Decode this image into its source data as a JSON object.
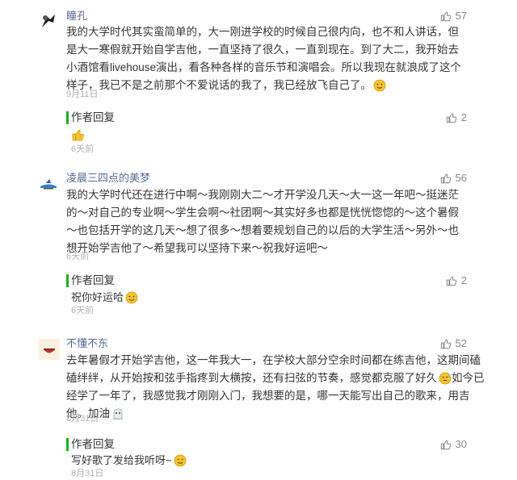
{
  "comments": [
    {
      "username": "瞳孔",
      "likes": "57",
      "text": "我的大学时代其实蛮简单的，大一刚进学校的时候自己很内向，也不和人讲话，但是大一寒假就开始自学吉他，一直坚持了很久，一直到现在。到了大二，我开始去小酒馆看livehouse演出，看各种各样的音乐节和演唱会。所以我现在就浪成了这个样子，我已不是之前那个不爱说话的我了，我已经放飞自己了。",
      "date": "9月11日",
      "reply": {
        "label": "作者回复",
        "likes": "2",
        "text": "",
        "date": "6天前",
        "emoji": "thumbs-up-emoji"
      }
    },
    {
      "username": "凌晨三四点的美梦",
      "likes": "56",
      "text": "我的大学时代还在进行中啊～我刚刚大二～才开学没几天～大一这一年吧～挺迷茫的～对自己的专业啊～学生会啊～社团啊～其实好多也都是恍恍惚惚的～这个暑假～也包括开学的这几天～想了很多～想着要规划自己的以后的大学生活～另外～也想开始学吉他了～希望我可以坚持下来～祝我好运吧～",
      "date": "6天前",
      "reply": {
        "label": "作者回复",
        "likes": "2",
        "text": "祝你好运哈",
        "date": "6天前",
        "emoji": "smile-emoji"
      }
    },
    {
      "username": "不懂不东",
      "likes": "52",
      "text_lines": [
        "去年暑假才开始学吉他，这一年我大一，在学校大部分空余时间都在练吉他，这期间磕",
        "磕绊绊，从开始按和弦手指疼到大横按，还有扫弦的节奏，感觉都克服了好久",
        "经学了一年了，我感觉我才刚刚入门，我想要的是，哪一天能写出自己的歌来，用吉",
        "他。加油"
      ],
      "line2_tail": "如今已",
      "date": "8月31日",
      "reply": {
        "label": "作者回复",
        "likes": "30",
        "text": "写好歌了发给我听呀~",
        "date": "8月31日",
        "emoji": "smile-emoji"
      }
    }
  ],
  "colors": {
    "accent_green": "#1aad19",
    "link_blue": "#576b95",
    "muted": "#b2b2b2"
  },
  "icons": {
    "like": "thumb-up-outline-icon"
  }
}
